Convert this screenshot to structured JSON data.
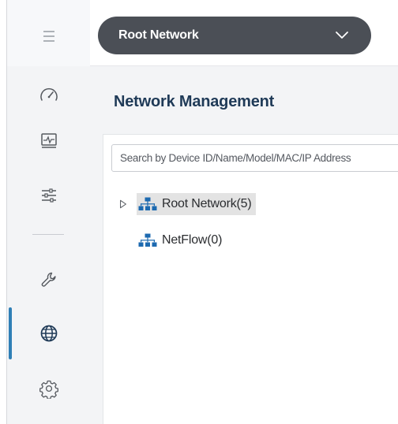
{
  "colors": {
    "accent": "#2f7fb6",
    "select_bg": "#4b4f56",
    "title": "#1f3a57",
    "tree_icon": "#1d6ab0"
  },
  "header": {
    "network_select": {
      "selected": "Root Network"
    }
  },
  "sidebar": {
    "items": [
      {
        "icon": "menu-icon"
      },
      {
        "icon": "dashboard-gauge-icon"
      },
      {
        "icon": "monitor-icon"
      },
      {
        "icon": "sliders-icon"
      },
      {
        "icon": "wrench-icon"
      },
      {
        "icon": "globe-icon",
        "active": true
      },
      {
        "icon": "gear-icon"
      }
    ]
  },
  "main": {
    "title": "Network Management",
    "search": {
      "placeholder": "Search by Device ID/Name/Model/MAC/IP Address",
      "value": ""
    },
    "tree": [
      {
        "label": "Root Network(5)",
        "expanded": false,
        "selected": true
      },
      {
        "label": "NetFlow(0)",
        "expanded": false,
        "selected": false
      }
    ]
  }
}
